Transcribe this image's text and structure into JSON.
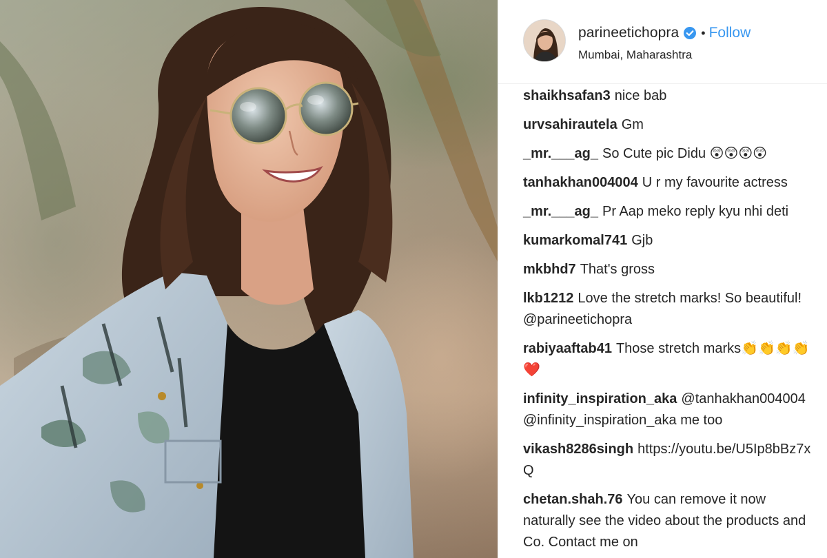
{
  "post": {
    "image_subject": "photo",
    "username": "parineetichopra",
    "verified": true,
    "separator": "•",
    "follow_label": "Follow",
    "location": "Mumbai, Maharashtra"
  },
  "comments": [
    {
      "handle": "shaikhsafan3",
      "text": "nice bab"
    },
    {
      "handle": "urvsahirautela",
      "text": "Gm"
    },
    {
      "handle": "_mr.___ag_",
      "text": "So Cute pic Didu 😲😲😲😲"
    },
    {
      "handle": "tanhakhan004004",
      "text": "U r my favourite actress"
    },
    {
      "handle": "_mr.___ag_",
      "text": "Pr Aap meko reply kyu nhi deti"
    },
    {
      "handle": "kumarkomal741",
      "text": "Gjb"
    },
    {
      "handle": "mkbhd7",
      "text": "That's gross"
    },
    {
      "handle": "lkb1212",
      "text": "Love the stretch marks! So beautiful! @parineetichopra"
    },
    {
      "handle": "rabiyaaftab41",
      "text": "Those stretch marks👏👏👏👏❤️"
    },
    {
      "handle": "infinity_inspiration_aka",
      "text": "@tanhakhan004004 @infinity_inspiration_aka me too"
    },
    {
      "handle": "vikash8286singh",
      "text": "https://youtu.be/U5Ip8bBz7xQ"
    },
    {
      "handle": "chetan.shah.76",
      "text": "You can remove it now naturally see the video about the products and Co. Contact me on"
    }
  ],
  "colors": {
    "follow": "#3897f0",
    "verified_badge": "#3897f0",
    "text": "#262626",
    "border": "#efefef"
  }
}
